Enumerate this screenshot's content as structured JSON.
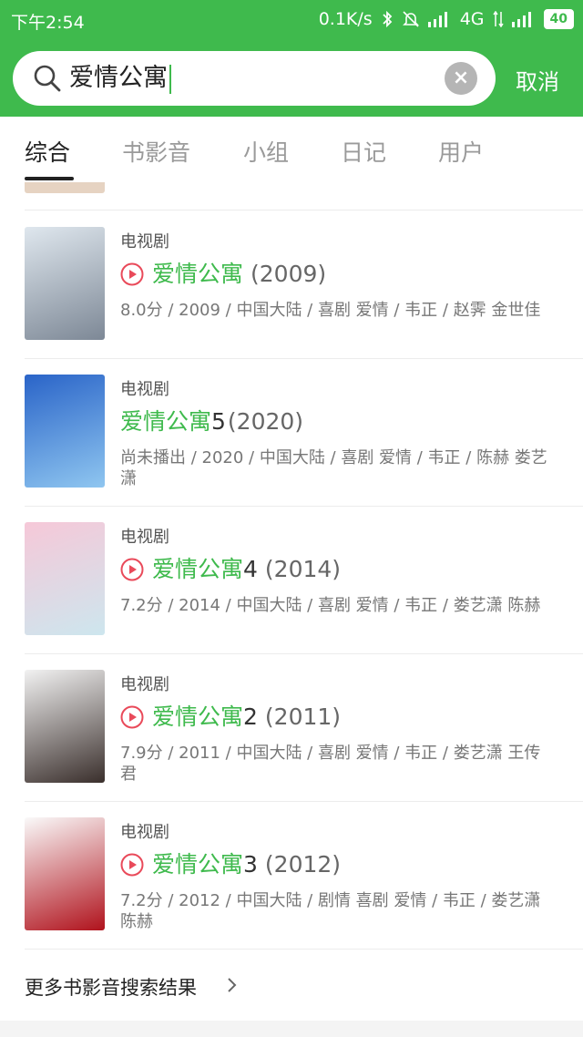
{
  "status": {
    "time": "下午2:54",
    "speed": "0.1K/s",
    "network": "4G",
    "battery": "40"
  },
  "search": {
    "query": "爱情公寓",
    "clear_symbol": "×",
    "cancel_label": "取消"
  },
  "tabs": [
    {
      "label": "综合",
      "active": true
    },
    {
      "label": "书影音",
      "active": false
    },
    {
      "label": "小组",
      "active": false
    },
    {
      "label": "日记",
      "active": false
    },
    {
      "label": "用户",
      "active": false
    }
  ],
  "results": [
    {
      "type": "电视剧",
      "has_play": true,
      "title_hl": "爱情公寓",
      "title_rest": "",
      "year": "(2009)",
      "meta": "8.0分 / 2009 / 中国大陆 / 喜剧 爱情 / 韦正 / 赵霁 金世佳",
      "poster_colors": [
        "#dfe7ee",
        "#7d8896"
      ]
    },
    {
      "type": "电视剧",
      "has_play": false,
      "title_hl": "爱情公寓",
      "title_rest": "5",
      "year": "(2020)",
      "meta": "尚未播出 / 2020 / 中国大陆 / 喜剧 爱情 / 韦正 / 陈赫 娄艺潇",
      "poster_colors": [
        "#2a64c8",
        "#8fc6f0"
      ]
    },
    {
      "type": "电视剧",
      "has_play": true,
      "title_hl": "爱情公寓",
      "title_rest": "4",
      "year": "(2014)",
      "meta": "7.2分 / 2014 / 中国大陆 / 喜剧 爱情 / 韦正 / 娄艺潇 陈赫",
      "poster_colors": [
        "#f6c8d8",
        "#cde6ee"
      ]
    },
    {
      "type": "电视剧",
      "has_play": true,
      "title_hl": "爱情公寓",
      "title_rest": "2",
      "year": "(2011)",
      "meta": "7.9分 / 2011 / 中国大陆 / 喜剧 爱情 / 韦正 / 娄艺潇 王传君",
      "poster_colors": [
        "#f2f2f2",
        "#3a2f2c"
      ]
    },
    {
      "type": "电视剧",
      "has_play": true,
      "title_hl": "爱情公寓",
      "title_rest": "3",
      "year": "(2012)",
      "meta": "7.2分 / 2012 / 中国大陆 / 剧情 喜剧 爱情 / 韦正 / 娄艺潇 陈赫",
      "poster_colors": [
        "#fafafa",
        "#b0121c"
      ]
    }
  ],
  "more_link": "更多书影音搜索结果",
  "colors": {
    "accent": "#3fba4d",
    "play": "#e94a5a"
  }
}
